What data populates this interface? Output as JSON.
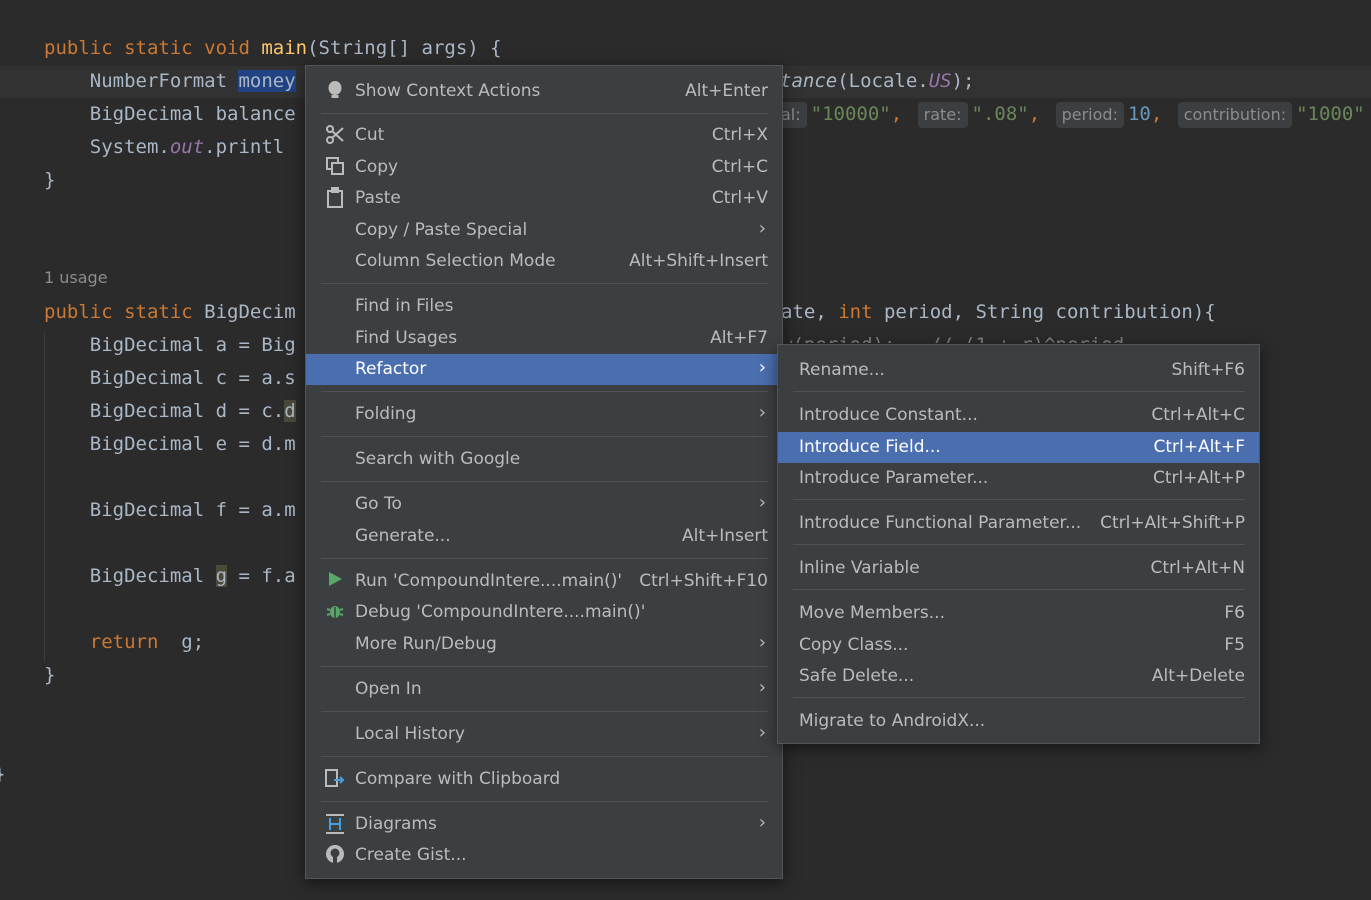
{
  "editor": {
    "line1": {
      "kw1": "public static void ",
      "fn": "main",
      "rest": "(String[] args) {"
    },
    "line2": {
      "pre": "    NumberFormat ",
      "sel": "money",
      "call_italic": "tance",
      "call_rest": "(Locale.",
      "const": "US",
      "end": ");"
    },
    "line3": {
      "pre": "    BigDecimal balance",
      "hint_principal": "al:",
      "val_principal": "\"10000\"",
      "hint_rate": "rate:",
      "val_rate": "\".08\"",
      "hint_period": "period:",
      "val_period": "10",
      "hint_contribution": "contribution:",
      "val_contribution": "\"1000\""
    },
    "line4": {
      "pre": "    System.",
      "field": "out",
      "rest": ".printl"
    },
    "line5": "}",
    "usage_label": "1 usage",
    "line7": {
      "kw": "public static ",
      "type": "BigDecim",
      "tail_pre": "ate, ",
      "tail_kw": "int",
      "tail_rest": " period, String contribution){"
    },
    "line8": "    BigDecimal a = Big",
    "line8_tail": "w(period);   // (1 + r)^period",
    "line9": "    BigDecimal c = a.s",
    "line10_pre": "    BigDecimal d = c.",
    "line10_hl": "d",
    "line11": "    BigDecimal e = d.m",
    "line12": "    BigDecimal f = a.m",
    "line13_pre": "    BigDecimal ",
    "line13_var": "g",
    "line13_rest": " = f.a",
    "line14": {
      "kw": "    return",
      "rest": "  g;"
    },
    "line15": "}",
    "line16": "}"
  },
  "context_menu": [
    {
      "label": "Show Context Actions",
      "shortcut": "Alt+Enter",
      "icon": "lightbulb-icon"
    },
    {
      "label": "Cut",
      "shortcut": "Ctrl+X",
      "icon": "scissors-icon"
    },
    {
      "label": "Copy",
      "shortcut": "Ctrl+C",
      "icon": "copy-icon"
    },
    {
      "label": "Paste",
      "shortcut": "Ctrl+V",
      "icon": "clipboard-icon"
    },
    {
      "label": "Copy / Paste Special",
      "shortcut": "",
      "submenu": true
    },
    {
      "label": "Column Selection Mode",
      "shortcut": "Alt+Shift+Insert"
    },
    {
      "label": "Find in Files",
      "shortcut": ""
    },
    {
      "label": "Find Usages",
      "shortcut": "Alt+F7"
    },
    {
      "label": "Refactor",
      "shortcut": "",
      "submenu": true,
      "highlighted": true
    },
    {
      "label": "Folding",
      "shortcut": "",
      "submenu": true
    },
    {
      "label": "Search with Google",
      "shortcut": ""
    },
    {
      "label": "Go To",
      "shortcut": "",
      "submenu": true
    },
    {
      "label": "Generate...",
      "shortcut": "Alt+Insert"
    },
    {
      "label": "Run 'CompoundIntere....main()'",
      "shortcut": "Ctrl+Shift+F10",
      "icon": "run-icon"
    },
    {
      "label": "Debug 'CompoundIntere....main()'",
      "shortcut": "",
      "icon": "debug-icon"
    },
    {
      "label": "More Run/Debug",
      "shortcut": "",
      "submenu": true
    },
    {
      "label": "Open In",
      "shortcut": "",
      "submenu": true
    },
    {
      "label": "Local History",
      "shortcut": "",
      "submenu": true
    },
    {
      "label": "Compare with Clipboard",
      "shortcut": "",
      "icon": "compare-clipboard-icon"
    },
    {
      "label": "Diagrams",
      "shortcut": "",
      "submenu": true,
      "icon": "diagram-icon"
    },
    {
      "label": "Create Gist...",
      "shortcut": "",
      "icon": "github-icon"
    }
  ],
  "refactor_submenu": [
    {
      "label": "Rename...",
      "shortcut": "Shift+F6"
    },
    {
      "label": "Introduce Constant...",
      "shortcut": "Ctrl+Alt+C"
    },
    {
      "label": "Introduce Field...",
      "shortcut": "Ctrl+Alt+F",
      "highlighted": true
    },
    {
      "label": "Introduce Parameter...",
      "shortcut": "Ctrl+Alt+P"
    },
    {
      "label": "Introduce Functional Parameter...",
      "shortcut": "Ctrl+Alt+Shift+P"
    },
    {
      "label": "Inline Variable",
      "shortcut": "Ctrl+Alt+N"
    },
    {
      "label": "Move Members...",
      "shortcut": "F6"
    },
    {
      "label": "Copy Class...",
      "shortcut": "F5"
    },
    {
      "label": "Safe Delete...",
      "shortcut": "Alt+Delete"
    },
    {
      "label": "Migrate to AndroidX...",
      "shortcut": ""
    }
  ],
  "colors": {
    "menu_bg": "#3c3f41",
    "highlight": "#4b6eaf",
    "editor_bg": "#2b2b2b",
    "keyword": "#cc7832"
  }
}
